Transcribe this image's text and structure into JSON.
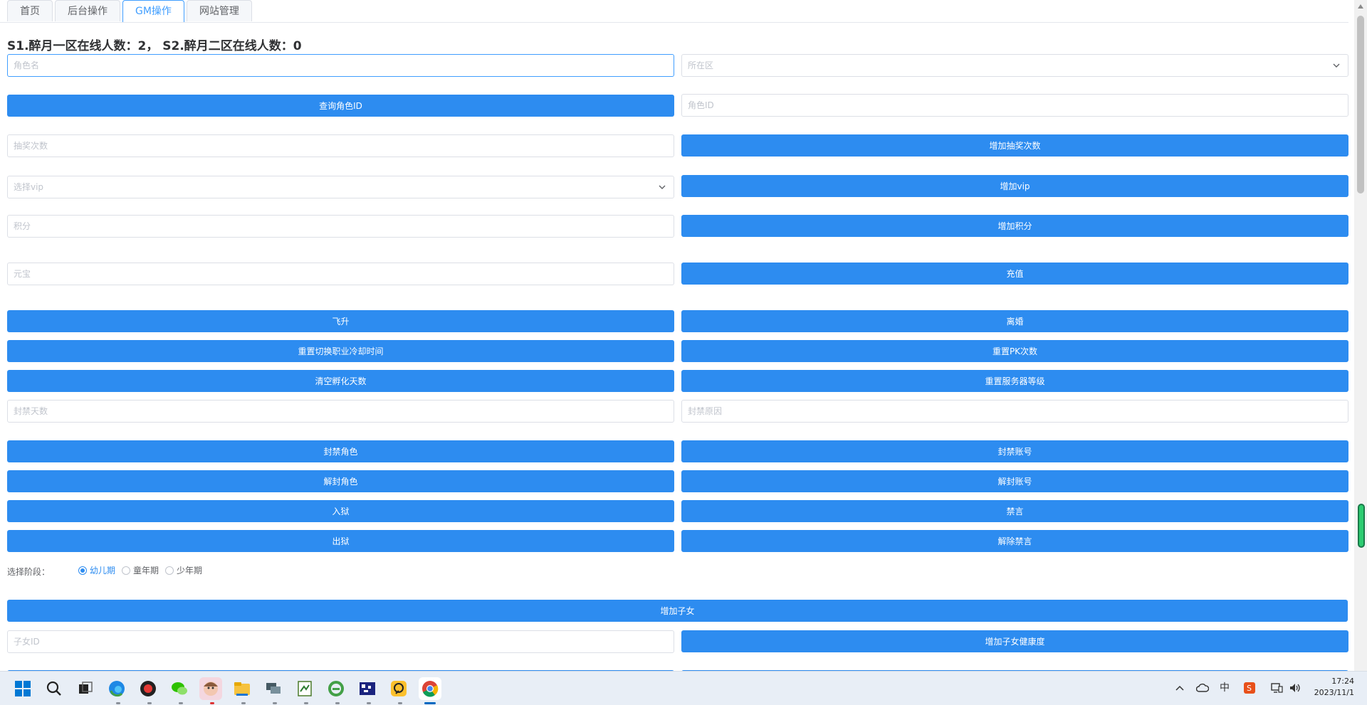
{
  "tabs": [
    {
      "label": "首页",
      "active": false
    },
    {
      "label": "后台操作",
      "active": false
    },
    {
      "label": "GM操作",
      "active": true
    },
    {
      "label": "网站管理",
      "active": false
    }
  ],
  "status_text": "S1.醉月一区在线人数：2， S2.醉月二区在线人数：0",
  "fields": {
    "role_name": {
      "placeholder": "角色名",
      "value": ""
    },
    "zone": {
      "placeholder": "所在区"
    },
    "role_id": {
      "placeholder": "角色ID",
      "value": ""
    },
    "lottery_count": {
      "placeholder": "抽奖次数",
      "value": ""
    },
    "vip": {
      "placeholder": "选择vip"
    },
    "points": {
      "placeholder": "积分",
      "value": ""
    },
    "yuanbao": {
      "placeholder": "元宝",
      "value": ""
    },
    "ban_days": {
      "placeholder": "封禁天数",
      "value": ""
    },
    "ban_reason": {
      "placeholder": "封禁原因",
      "value": ""
    },
    "child_id": {
      "placeholder": "子女ID",
      "value": ""
    }
  },
  "buttons": {
    "query_role_id": "查询角色ID",
    "add_lottery": "增加抽奖次数",
    "add_vip": "增加vip",
    "add_points": "增加积分",
    "recharge": "充值",
    "ascend": "飞升",
    "divorce": "离婚",
    "reset_job_cd": "重置切换职业冷却时间",
    "reset_pk": "重置PK次数",
    "clear_incubation": "清空孵化天数",
    "reset_server_level": "重置服务器等级",
    "ban_role": "封禁角色",
    "ban_account": "封禁账号",
    "unban_role": "解封角色",
    "unban_account": "解封账号",
    "jail": "入狱",
    "mute": "禁言",
    "release": "出狱",
    "unmute": "解除禁言",
    "add_child": "增加子女",
    "add_child_health": "增加子女健康度"
  },
  "stage": {
    "label": "选择阶段：",
    "options": [
      "幼儿期",
      "童年期",
      "少年期"
    ],
    "selected": "幼儿期"
  },
  "taskbar": {
    "apps": [
      "start-icon",
      "search-icon",
      "task-view-icon",
      "edge-icon",
      "recorder-icon",
      "wechat-icon",
      "avatar-app-icon",
      "file-explorer-icon",
      "remote-desktop-icon",
      "notepad-icon",
      "ie-icon",
      "qr-app-icon",
      "app-icon",
      "chrome-icon"
    ],
    "active_app": "chrome-icon",
    "clock_time": "17:24",
    "clock_date": "2023/11/1",
    "ime": "中"
  },
  "colors": {
    "primary": "#2d8cf0",
    "tab_active": "#409eff",
    "border": "#dcdfe6",
    "placeholder": "#c0c4cc"
  }
}
